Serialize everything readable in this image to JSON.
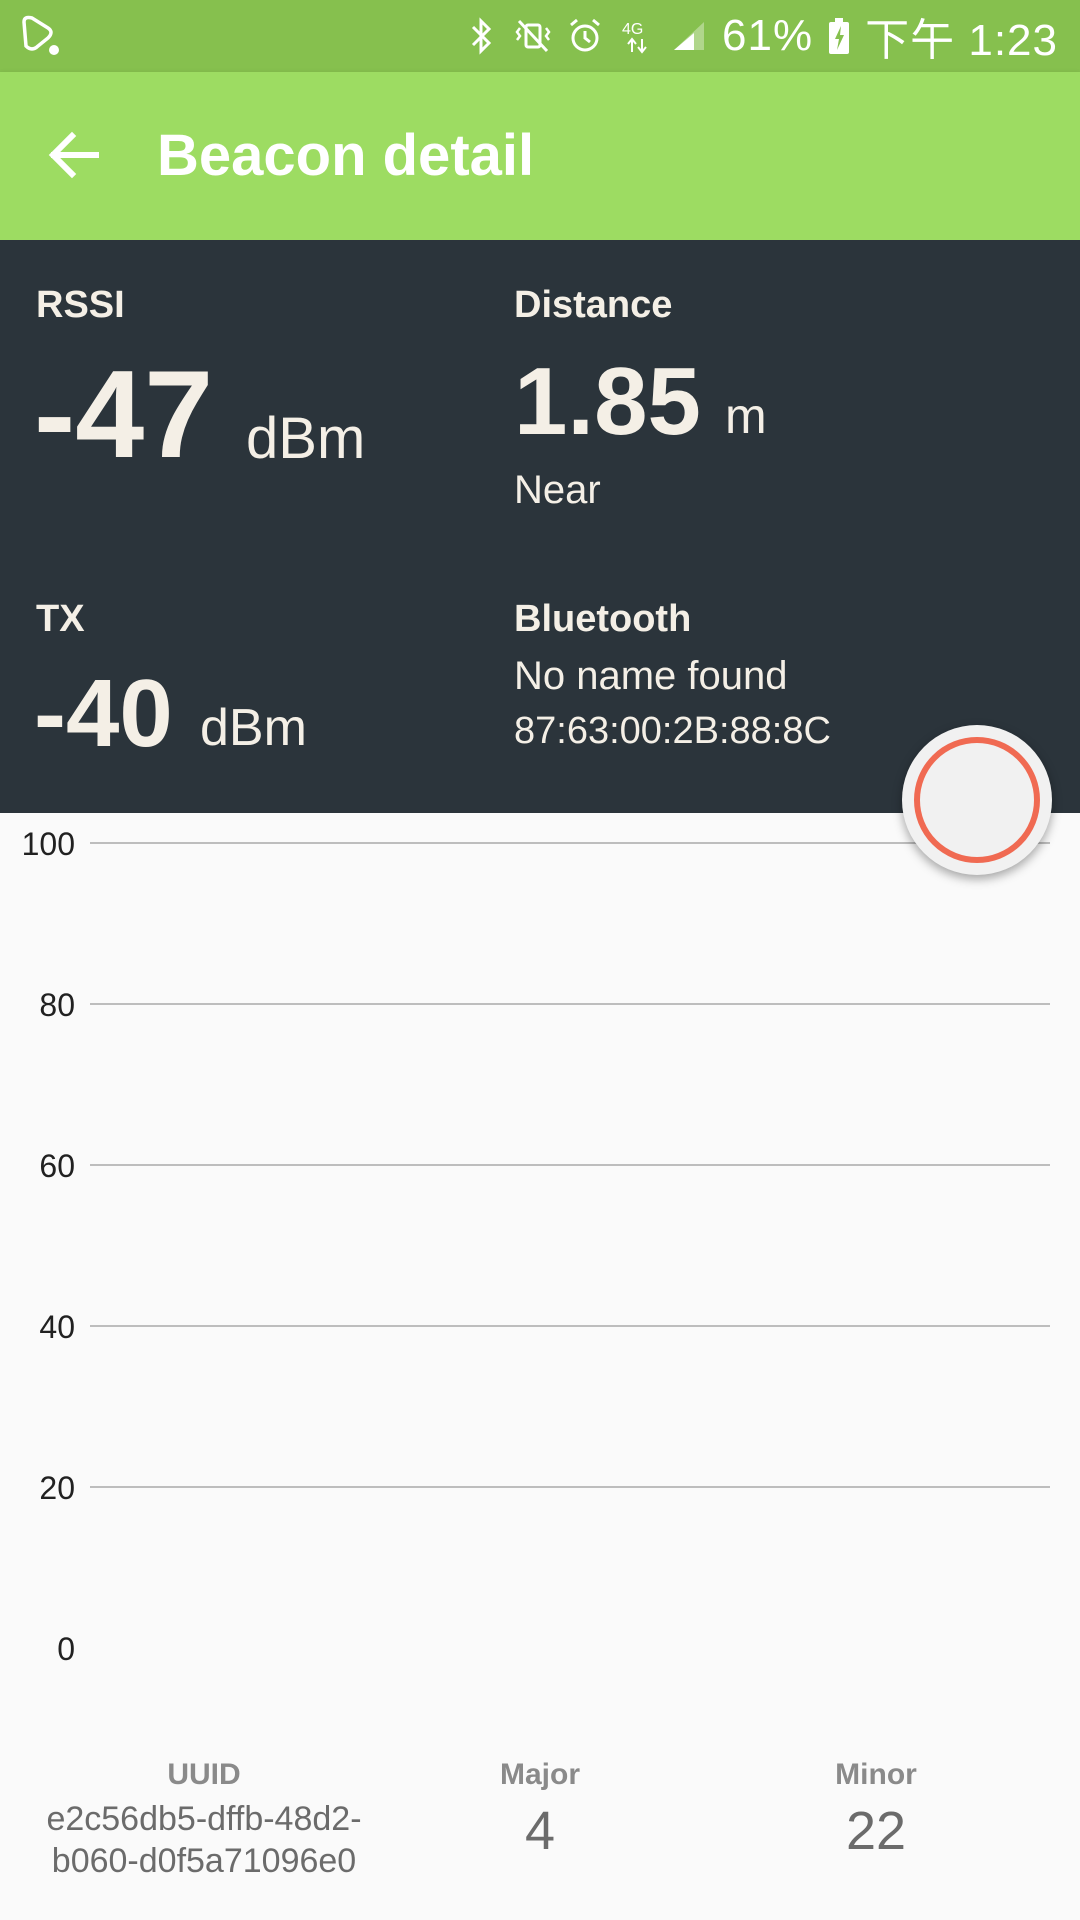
{
  "status_bar": {
    "battery": "61%",
    "time": "下午 1:23",
    "network": "4G",
    "icons": [
      "chat-bubble-icon",
      "bluetooth-icon",
      "vibrate-icon",
      "alarm-icon",
      "network-4g-icon",
      "signal-icon",
      "battery-charging-icon"
    ]
  },
  "app_bar": {
    "title": "Beacon detail",
    "back_icon": "arrow-back-icon"
  },
  "stats": {
    "rssi": {
      "label": "RSSI",
      "value": "-47",
      "unit": "dBm"
    },
    "distance": {
      "label": "Distance",
      "value": "1.85",
      "unit": "m",
      "proximity": "Near"
    },
    "tx": {
      "label": "TX",
      "value": "-40",
      "unit": "dBm"
    },
    "bluetooth": {
      "label": "Bluetooth",
      "name": "No name found",
      "address": "87:63:00:2B:88:8C"
    }
  },
  "fab": {
    "icon": "record-icon"
  },
  "chart_data": {
    "type": "line",
    "title": "",
    "xlabel": "",
    "ylabel": "",
    "ylim": [
      0,
      100
    ],
    "y_ticks": [
      "100",
      "80",
      "60",
      "40",
      "20",
      "0"
    ],
    "grid": true,
    "series": []
  },
  "footer": {
    "uuid": {
      "label": "UUID",
      "line1": "e2c56db5-dffb-48d2-",
      "line2": "b060-d0f5a71096e0"
    },
    "major": {
      "label": "Major",
      "value": "4"
    },
    "minor": {
      "label": "Minor",
      "value": "22"
    }
  },
  "colors": {
    "status_bar": "#86c04e",
    "app_bar": "#9ddc62",
    "panel": "#2b343b",
    "panel_text": "#f4efe6",
    "fab_ring": "#f06a52"
  }
}
